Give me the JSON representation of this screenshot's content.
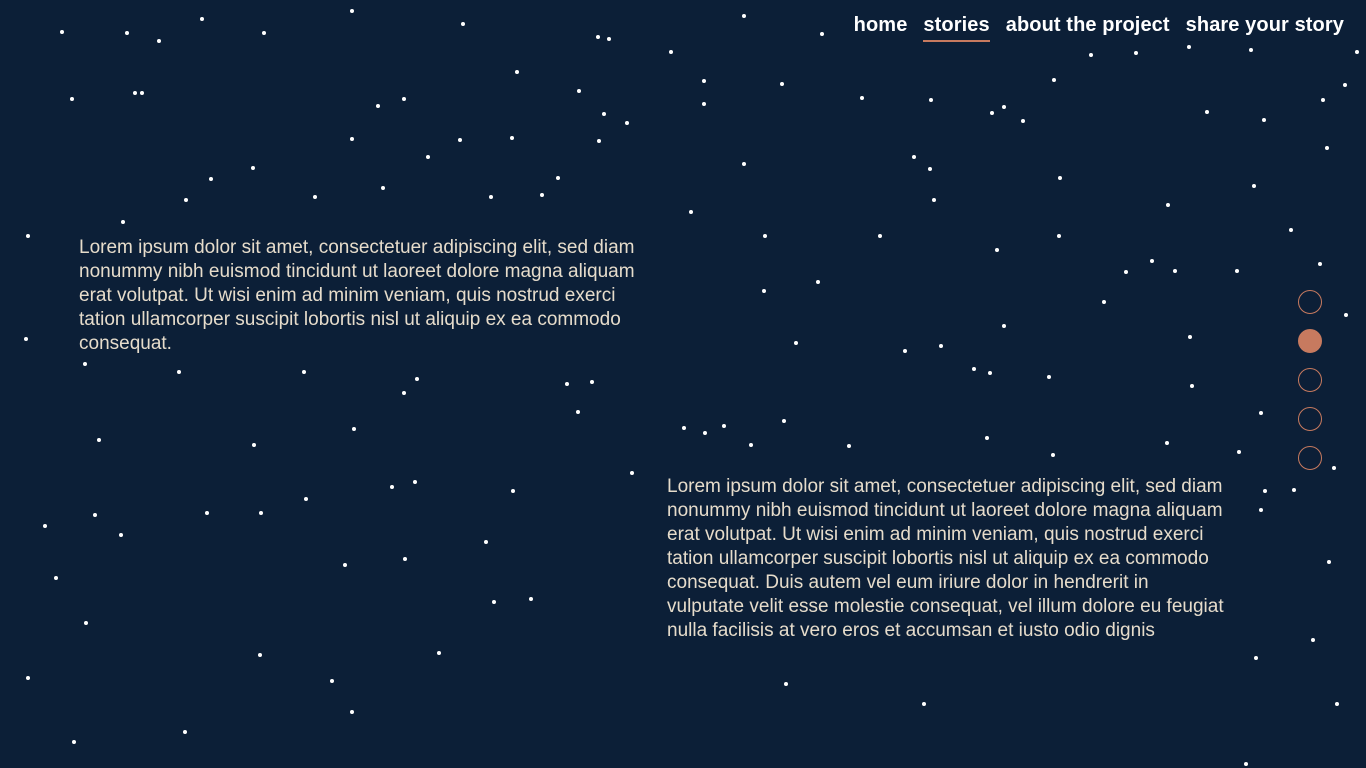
{
  "colors": {
    "background": "#0c1f37",
    "accent": "#c77a5f",
    "text": "#e6dccb",
    "star": "#ffffff"
  },
  "nav": {
    "items": [
      {
        "label": "home",
        "active": false
      },
      {
        "label": "stories",
        "active": true
      },
      {
        "label": "about the project",
        "active": false
      },
      {
        "label": "share your story",
        "active": false
      }
    ]
  },
  "stories": [
    {
      "text": "Lorem ipsum dolor sit amet, consectetuer adipiscing elit, sed diam nonummy nibh euismod tincidunt ut laoreet dolore magna aliquam erat volutpat. Ut wisi enim ad minim veniam, quis nostrud exerci tation ullamcorper suscipit lobortis nisl ut aliquip ex ea commodo consequat."
    },
    {
      "text": "Lorem ipsum dolor sit amet, consectetuer adipiscing elit, sed diam nonummy nibh euismod tincidunt ut laoreet dolore magna aliquam erat volutpat. Ut wisi enim ad minim veniam, quis nostrud exerci tation ullamcorper suscipit lobortis nisl ut aliquip ex ea commodo consequat. Duis autem vel eum iriure dolor in hendrerit in vulputate velit esse molestie consequat, vel illum dolore eu feugiat nulla facilisis at vero eros et accumsan et iusto odio dignis"
    }
  ],
  "pagination": {
    "total": 5,
    "current": 2
  }
}
